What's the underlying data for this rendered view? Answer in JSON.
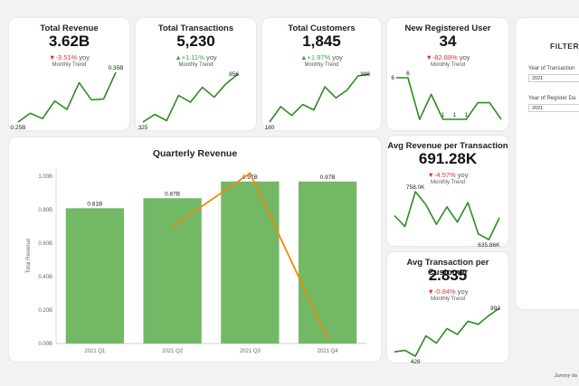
{
  "kpis": [
    {
      "title": "Total Revenue",
      "value": "3.62B",
      "delta": "▼-3.51%",
      "delta_dir": "neg",
      "yoy": " yoy",
      "trend_label": "Monthly Trend",
      "spark": [
        0.25,
        0.48,
        0.34,
        0.8,
        0.58,
        1.28,
        0.83,
        0.85,
        1.55
      ],
      "labels": [
        {
          "i": 0,
          "text": "0.25B",
          "pos": "below"
        },
        {
          "i": 8,
          "text": "0.35B",
          "pos": "above"
        }
      ]
    },
    {
      "title": "Total Transactions",
      "value": "5,230",
      "delta": "▲+1.11%",
      "delta_dir": "pos",
      "yoy": " yoy",
      "trend_label": "Monthly Trend",
      "spark": [
        325,
        410,
        340,
        620,
        545,
        710,
        600,
        750,
        856
      ],
      "labels": [
        {
          "i": 0,
          "text": "325",
          "pos": "below"
        },
        {
          "i": 8,
          "text": "856",
          "pos": "right"
        }
      ]
    },
    {
      "title": "Total Customers",
      "value": "1,845",
      "delta": "▲+1.97%",
      "delta_dir": "pos",
      "yoy": " yoy",
      "trend_label": "Monthly Trend",
      "spark": [
        180,
        250,
        210,
        260,
        235,
        340,
        290,
        325,
        390,
        398
      ],
      "labels": [
        {
          "i": 0,
          "text": "180",
          "pos": "below"
        },
        {
          "i": 9,
          "text": "398",
          "pos": "right"
        }
      ]
    },
    {
      "title": "New Registered User",
      "value": "34",
      "delta": "▼-82.88%",
      "delta_dir": "neg",
      "yoy": " yoy",
      "trend_label": "Monthly Trend",
      "spark": [
        6,
        6,
        1,
        4,
        1,
        1,
        1,
        3,
        3,
        1
      ],
      "labels": [
        {
          "i": 0,
          "text": "6",
          "pos": "left"
        },
        {
          "i": 1,
          "text": "6",
          "pos": "above"
        },
        {
          "i": 4,
          "text": "1",
          "pos": "above"
        },
        {
          "i": 5,
          "text": "1",
          "pos": "above"
        },
        {
          "i": 6,
          "text": "1",
          "pos": "above"
        }
      ]
    }
  ],
  "quarterly": {
    "title": "Quarterly Revenue",
    "ylabel": "Total Revenue",
    "yticks": [
      "0.00B",
      "0.20B",
      "0.40B",
      "0.60B",
      "0.80B",
      "1.00B"
    ],
    "categories": [
      "2021 Q1",
      "2021 Q2",
      "2021 Q3",
      "2021 Q4"
    ],
    "bar_labels": [
      "0.81B",
      "0.87B",
      "0.97B",
      "0.97B"
    ]
  },
  "chart_data": {
    "type": "bar",
    "categories": [
      "2021 Q1",
      "2021 Q2",
      "2021 Q3",
      "2021 Q4"
    ],
    "values": [
      0.81,
      0.87,
      0.97,
      0.97
    ],
    "line_values": [
      null,
      0.7,
      1.02,
      0.03
    ],
    "title": "Quarterly Revenue",
    "xlabel": "",
    "ylabel": "Total Revenue",
    "ylim": [
      0,
      1.05
    ],
    "colors": {
      "bar": "#72b865",
      "line": "#f0880a"
    }
  },
  "avg_rev": {
    "title": "Avg Revenue per Transaction",
    "value": "691.28K",
    "delta": "▼-4.57%",
    "delta_dir": "neg",
    "yoy": " yoy",
    "trend_label": "Monthly Trend",
    "spark": [
      650,
      600,
      760,
      700,
      610,
      690,
      620,
      710,
      565,
      540,
      640
    ],
    "labels": [
      {
        "i": 2,
        "text": "758.0K",
        "pos": "above"
      },
      {
        "i": 9,
        "text": "635.86K",
        "pos": "below"
      }
    ]
  },
  "avg_tx": {
    "title": "Avg Transaction per Customer",
    "value": "2.835",
    "delta": "▼-0.84%",
    "delta_dir": "neg",
    "yoy": " yoy",
    "trend_label": "Monthly Trend",
    "spark": [
      2.63,
      2.64,
      2.6,
      2.74,
      2.69,
      2.79,
      2.75,
      2.84,
      2.82,
      2.88,
      2.93
    ],
    "labels": [
      {
        "i": 2,
        "text": "428",
        "pos": "below"
      },
      {
        "i": 10,
        "text": "893",
        "pos": "right"
      }
    ]
  },
  "filter": {
    "title": "FILTER",
    "year_tx_label": "Year of Transaction",
    "year_tx_value": "2021",
    "year_reg_label": "Year of Register Da",
    "year_reg_value": "2021"
  },
  "footer": {
    "credit": "Jummy da"
  },
  "colors": {
    "spark": "#2e8b22",
    "bar": "#72b865",
    "line": "#f0880a",
    "neg": "#e0312f",
    "pos": "#3aa53a"
  }
}
